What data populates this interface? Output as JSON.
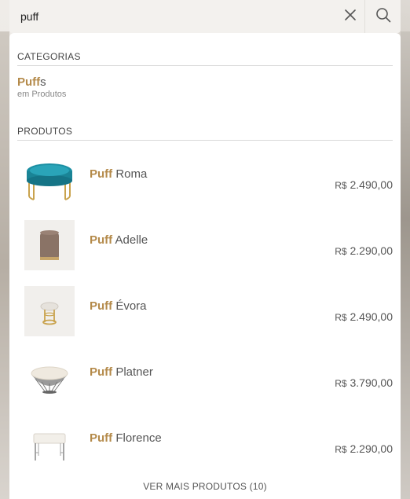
{
  "search": {
    "value": "puff",
    "clear_icon": "close-icon",
    "submit_icon": "search-icon"
  },
  "categories": {
    "title": "CATEGORIAS",
    "items": [
      {
        "highlight": "Puff",
        "rest": "s",
        "sub": "em Produtos"
      }
    ]
  },
  "products": {
    "title": "PRODUTOS",
    "items": [
      {
        "highlight": "Puff",
        "name": " Roma",
        "currency": "R$",
        "price": "2.490,00"
      },
      {
        "highlight": "Puff",
        "name": " Adelle",
        "currency": "R$",
        "price": "2.290,00"
      },
      {
        "highlight": "Puff",
        "name": " Évora",
        "currency": "R$",
        "price": "2.490,00"
      },
      {
        "highlight": "Puff",
        "name": " Platner",
        "currency": "R$",
        "price": "3.790,00"
      },
      {
        "highlight": "Puff",
        "name": " Florence",
        "currency": "R$",
        "price": "2.290,00"
      }
    ]
  },
  "footer": {
    "more_label": "VER MAIS PRODUTOS (10)"
  },
  "colors": {
    "highlight": "#b48a4a",
    "text": "#555555"
  }
}
